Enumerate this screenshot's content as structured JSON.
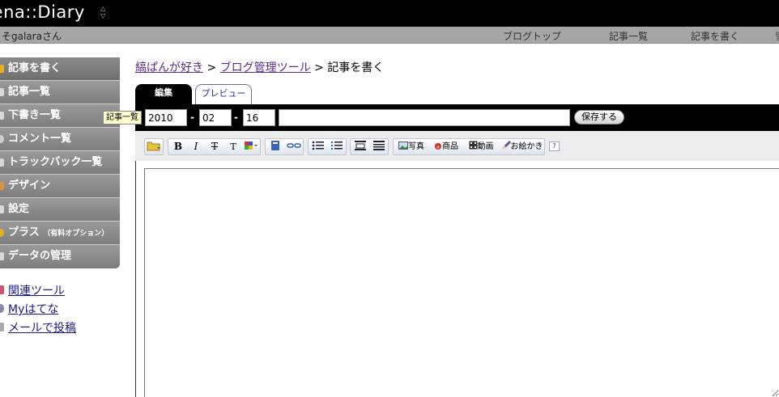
{
  "header": {
    "logo_text": "rena::Diary",
    "logo_arrows": "◇"
  },
  "subbar": {
    "user_text": "そgalaraさん",
    "nav": [
      "ブログトップ",
      "記事一覧",
      "記事を書く",
      "管"
    ]
  },
  "sidebar": {
    "menu": [
      "記事を書く",
      "記事一覧",
      "下書き一覧",
      "コメント一覧",
      "トラックバック一覧",
      "デザイン",
      "設定",
      "プラス",
      "データの管理"
    ],
    "plus_suffix": "（有料オプション）",
    "links": [
      "関連ツール",
      "Myはてな",
      "メールで投稿"
    ],
    "icon_colors": [
      "#e8b020",
      "#d8d8d8",
      "#d8d8d8",
      "#cfcfcf",
      "#d8d8d8",
      "#e09040",
      "#d8d8d8",
      "#e8b020",
      "#d8d8d8"
    ],
    "link_icon_colors": [
      "#d05070",
      "#8888aa",
      "#aaaaaa"
    ]
  },
  "breadcrumb": {
    "link1": "縞ぱんが好き",
    "sep": " > ",
    "link2": "ブログ管理ツール",
    "current": "記事を書く"
  },
  "tabs": {
    "edit": "編集",
    "preview": "プレビュー"
  },
  "date": {
    "year": "2010",
    "month": "02",
    "day": "16",
    "separator": "-",
    "title_value": ""
  },
  "save_label": "保存する",
  "tooltip": "記事一覧",
  "toolbar": {
    "folder_icon": "📁",
    "bold": "B",
    "italic": "I",
    "strike": "T",
    "size": "T",
    "photo": "写真",
    "product": "商品",
    "video": "動画",
    "drawing": "お絵かき",
    "help": "?"
  },
  "colors": {
    "header_bg": "#000000",
    "subbar_bg": "#a6a6a6",
    "menu_bg": "#8a8a8a",
    "link": "#1a1a8c",
    "breadcrumb_link": "#5a2d8c"
  }
}
